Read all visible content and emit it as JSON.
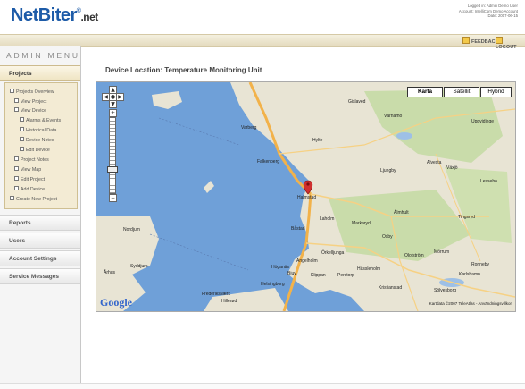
{
  "header": {
    "logo_main": "NetBiter",
    "logo_reg": "®",
    "logo_suffix": ".net",
    "login_lines": [
      "Logged in: Admin Demo User",
      "Account: IntelliCom Demo Account",
      "Date: 2007-06-15"
    ],
    "feedback_label": "FEEDBACK",
    "logout_label": "LOGOUT"
  },
  "sidebar": {
    "title": "ADMIN MENU",
    "sections": {
      "projects": "Projects",
      "reports": "Reports",
      "users": "Users",
      "account_settings": "Account Settings",
      "service_messages": "Service Messages"
    },
    "project_items": [
      "Projects Overview",
      "View Project",
      "View Device",
      "Alarms & Events",
      "Historical Data",
      "Device Notes",
      "Edit Device",
      "Project Notes",
      "View Map",
      "Edit Project",
      "Add Device",
      "Create New Project"
    ]
  },
  "main": {
    "title": "Device Location: Temperature Monitoring Unit"
  },
  "map": {
    "map_types": [
      "Karta",
      "Satellit",
      "Hybrid"
    ],
    "selected_type": "Karta",
    "zoom_in": "+",
    "zoom_out": "−",
    "google_logo": "Google",
    "copyright": "Kartdata ©2007 TeleAtlas - Användningsvillkor",
    "places": {
      "halmstad": "Halmstad",
      "falkenberg": "Falkenberg",
      "varberg": "Varberg",
      "nordjum": "Nordjum",
      "arhus": "Århus",
      "syddjurs": "Syddjurs",
      "helsingborg": "Helsingborg",
      "angelholm": "Ängelholm",
      "laholm": "Laholm",
      "bastad": "Båstad",
      "markaryd": "Markaryd",
      "ljungby": "Ljungby",
      "vaxjo": "Växjö",
      "alvesta": "Alvesta",
      "gislaved": "Gislaved",
      "hassleholm": "Hässleholm",
      "kristianstad": "Kristianstad",
      "olofstrom": "Olofström",
      "karlshamn": "Karlshamn",
      "solvesborg": "Sölvesborg",
      "osby": "Osby",
      "almhult": "Älmhult",
      "tingsryd": "Tingsryd",
      "hyltе": "Hylte",
      "varnamo": "Värnamo",
      "hoganas": "Höganäs",
      "bjuv": "Bjuv",
      "klippan": "Klippan",
      "perstorp": "Perstorp",
      "frederiksvarde": "Frederiksværk",
      "hillerod": "Hillerød",
      "ronneby": "Ronneby",
      "uppvidinge": "Uppvidinge",
      "lessebo": "Lessebo",
      "orkelljunga": "Örkelljunga",
      "morrum": "Mörrum"
    },
    "colors": {
      "sea": "#6fa0d8",
      "land": "#e8e4d4",
      "forest": "#c9dcaa",
      "road_major": "#f2b24a",
      "marker": "#d03030"
    }
  }
}
